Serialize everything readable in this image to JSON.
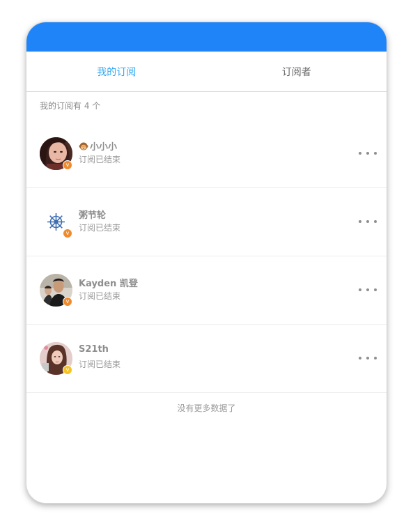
{
  "tabs": [
    {
      "label": "我的订阅",
      "active": true
    },
    {
      "label": "订阅者",
      "active": false
    }
  ],
  "summary": "我的订阅有 4 个",
  "subscriptions": [
    {
      "name": "小小小",
      "prefix_icon": "monkey-emoji",
      "status": "订阅已结束",
      "badge": "v",
      "badge_color": "#ef8b2c"
    },
    {
      "name": "粥节轮",
      "status": "订阅已结束",
      "badge": "v",
      "badge_color": "#ef8b2c"
    },
    {
      "name": "Kayden 凯登",
      "status": "订阅已结束",
      "badge": "v",
      "badge_color": "#ef8b2c"
    },
    {
      "name": "S21th",
      "status": "订阅已结束",
      "badge": "v",
      "badge_color": "#f5c324"
    }
  ],
  "footer": "没有更多数据了",
  "colors": {
    "header": "#1f84f8",
    "active_tab": "#2ea7f3"
  }
}
